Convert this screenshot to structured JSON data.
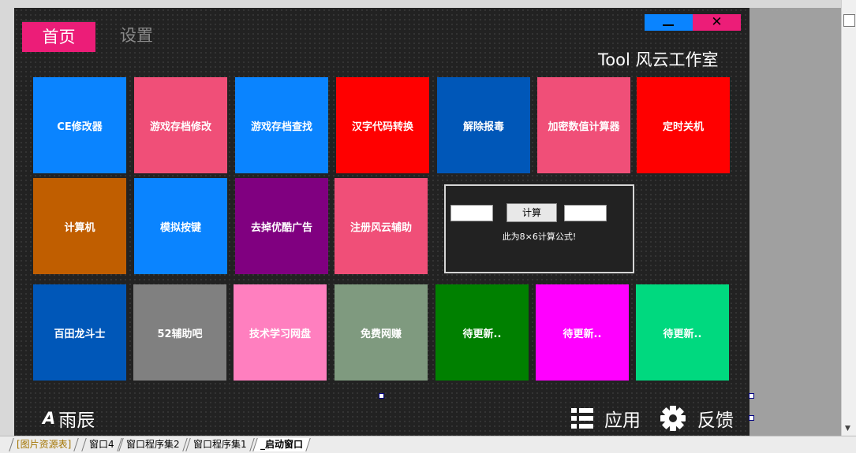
{
  "tabs": [
    {
      "label": "首页"
    },
    {
      "label": "设置"
    }
  ],
  "window": {
    "minimize_icon": "minimize-icon",
    "close_glyph": "✕"
  },
  "header": {
    "title": "Tool 风云工作室"
  },
  "tiles": [
    {
      "label": "CE修改器",
      "color": "#0a84ff"
    },
    {
      "label": "游戏存档修改",
      "color": "#f04f78"
    },
    {
      "label": "游戏存档查找",
      "color": "#0a84ff"
    },
    {
      "label": "汉字代码转换",
      "color": "#ff0000"
    },
    {
      "label": "解除报毒",
      "color": "#0057b8"
    },
    {
      "label": "加密数值计算器",
      "color": "#f04f78"
    },
    {
      "label": "定时关机",
      "color": "#ff0000"
    },
    {
      "label": "计算机",
      "color": "#c05e00"
    },
    {
      "label": "模拟按键",
      "color": "#0a84ff"
    },
    {
      "label": "去掉优酷广告",
      "color": "#800080"
    },
    {
      "label": "注册风云辅助",
      "color": "#f04f78"
    },
    {
      "label": "百田龙斗士",
      "color": "#0057b8"
    },
    {
      "label": "52辅助吧",
      "color": "#808080"
    },
    {
      "label": "技术学习网盘",
      "color": "#ff7fbf"
    },
    {
      "label": "免费网赚",
      "color": "#7f9a7f"
    },
    {
      "label": "待更新..",
      "color": "#008000"
    },
    {
      "label": "待更新..",
      "color": "#ff00ff"
    },
    {
      "label": "待更新..",
      "color": "#00d97f"
    }
  ],
  "calculator": {
    "input_a": "",
    "input_b": "",
    "button_label": "计算",
    "note": "此为8×6计算公式!"
  },
  "footer": {
    "brand_mark": "A",
    "brand_name": "雨辰",
    "apps_icon": "grid-list-icon",
    "apps_label": "应用",
    "feedback_icon": "gear-icon",
    "feedback_label": "反馈"
  },
  "designer_tabs": [
    {
      "label": "[图片资源表]"
    },
    {
      "label": "窗口4"
    },
    {
      "label": "窗口程序集2"
    },
    {
      "label": "窗口程序集1"
    },
    {
      "label": "_启动窗口"
    }
  ]
}
